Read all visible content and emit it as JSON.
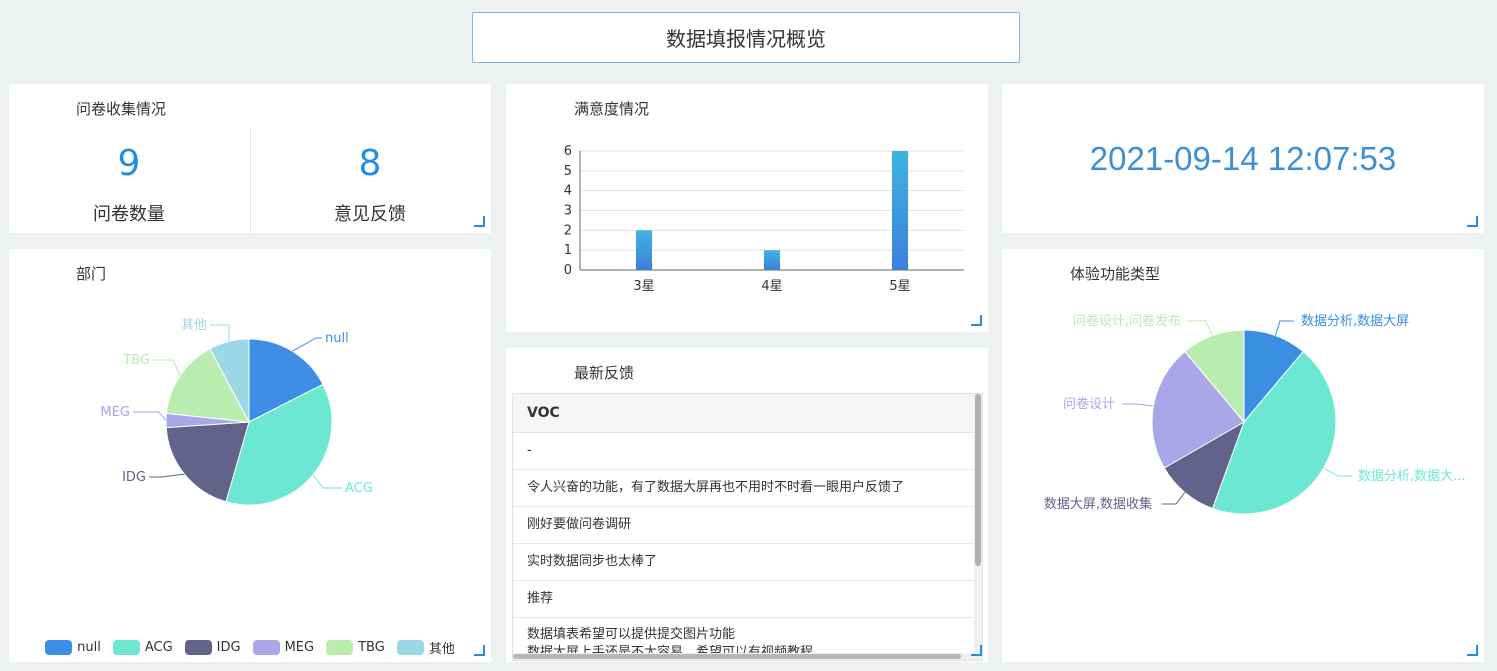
{
  "page_title": "数据填报情况概览",
  "survey": {
    "title": "问卷收集情况",
    "count_value": "9",
    "count_label": "问卷数量",
    "feedback_value": "8",
    "feedback_label": "意见反馈"
  },
  "satisfaction": {
    "title": "满意度情况"
  },
  "clock": {
    "datetime": "2021-09-14 12:07:53"
  },
  "department": {
    "title": "部门"
  },
  "feedback": {
    "title": "最新反馈",
    "column": "VOC",
    "rows": [
      "-",
      "令人兴奋的功能，有了数据大屏再也不用时不时看一眼用户反馈了",
      "刚好要做问卷调研",
      "实时数据同步也太棒了",
      "推荐",
      "数据填表希望可以提供提交图片功能",
      "数据大屏上手还是不太容易，希望可以有视频教程"
    ]
  },
  "features": {
    "title": "体验功能类型"
  },
  "colors": {
    "accent": "#1f8fe0",
    "clock": "#3b8fd8"
  },
  "chart_data": [
    {
      "type": "bar",
      "categories": [
        "3星",
        "4星",
        "5星"
      ],
      "values": [
        2,
        1,
        6
      ],
      "ylim": [
        0,
        6
      ],
      "yticks": [
        "0",
        "1",
        "2",
        "3",
        "4",
        "5",
        "6"
      ],
      "grid": true
    },
    {
      "type": "pie",
      "labels": [
        "null",
        "ACG",
        "IDG",
        "MEG",
        "TBG",
        "其他"
      ],
      "values": [
        4.5,
        9.5,
        5,
        0.7,
        4,
        2
      ],
      "colors": [
        "#3f8ee6",
        "#6ce8d2",
        "#62628a",
        "#aaa6e8",
        "#b9ecaf",
        "#9ad8e8"
      ],
      "legend": "bottom"
    },
    {
      "type": "pie",
      "labels": [
        "数据分析,数据大屏",
        "数据分析,数据大...",
        "数据大屏,数据收集",
        "问卷设计",
        "问卷设计,问卷发布"
      ],
      "values": [
        1,
        4,
        1,
        2,
        1
      ],
      "colors": [
        "#3a8fe2",
        "#6ce8d2",
        "#62628a",
        "#aaa6e8",
        "#b9ecaf"
      ],
      "legend": "none"
    }
  ]
}
